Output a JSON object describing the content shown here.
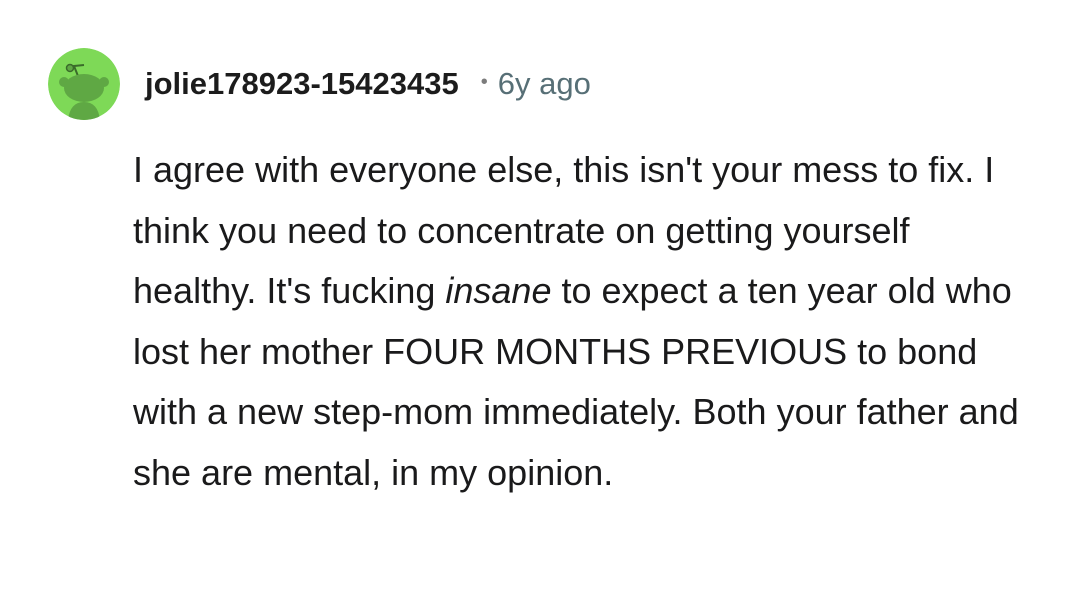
{
  "comment": {
    "author": "jolie178923-15423435",
    "separator": "•",
    "age": "6y ago",
    "avatar_icon": "reddit-snoo-icon",
    "avatar_color": "#7ED957",
    "body": {
      "part1": "I agree with everyone else, this isn't your mess to fix. I think you need to concentrate on getting yourself healthy. It's fucking ",
      "emphasis": "insane",
      "part2": " to expect a ten year old who lost her mother FOUR MONTHS PREVIOUS to bond with a new step-mom immediately. Both your father and she are mental, in my opinion."
    }
  }
}
